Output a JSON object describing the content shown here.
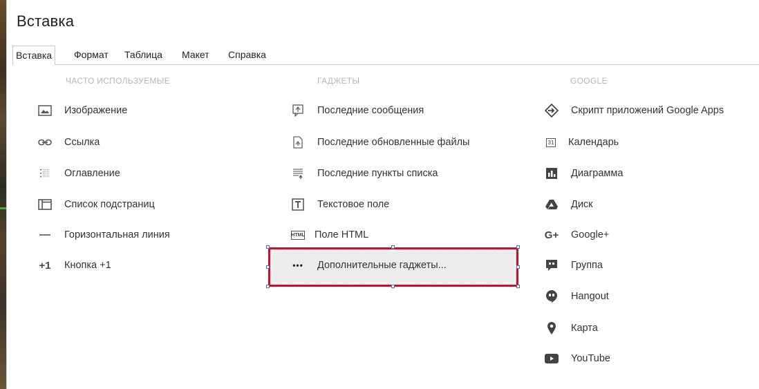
{
  "window": {
    "title": "Вставка"
  },
  "menubar": {
    "tabs": [
      {
        "label": "Вставка",
        "active": true
      },
      {
        "label": "Формат"
      },
      {
        "label": "Таблица"
      },
      {
        "label": "Макет"
      },
      {
        "label": "Справка"
      }
    ]
  },
  "columns": {
    "frequent": {
      "header": "ЧАСТО ИСПОЛЬЗУЕМЫЕ",
      "items": [
        {
          "label": "Изображение",
          "icon": "image-icon"
        },
        {
          "label": "Ссылка",
          "icon": "link-icon"
        },
        {
          "label": "Оглавление",
          "icon": "table-of-contents-icon"
        },
        {
          "label": "Список подстраниц",
          "icon": "subpage-list-icon"
        },
        {
          "label": "Горизонтальная линия",
          "icon": "horizontal-line-icon"
        },
        {
          "label": "Кнопка +1",
          "icon": "plus-one-icon",
          "icon_text": "+1"
        }
      ]
    },
    "gadgets": {
      "header": "ГАДЖЕТЫ",
      "items": [
        {
          "label": "Последние сообщения",
          "icon": "recent-posts-icon"
        },
        {
          "label": "Последние обновленные файлы",
          "icon": "recent-files-icon"
        },
        {
          "label": "Последние пункты списка",
          "icon": "recent-list-items-icon"
        },
        {
          "label": "Текстовое поле",
          "icon": "text-box-icon"
        },
        {
          "label": "Поле HTML",
          "icon": "html-box-icon",
          "icon_text": "HTML"
        },
        {
          "label": "Дополнительные гаджеты...",
          "icon": "more-dots-icon",
          "icon_text": "•••",
          "selected": true
        }
      ]
    },
    "google": {
      "header": "GOOGLE",
      "items": [
        {
          "label": "Скрипт приложений Google Apps",
          "icon": "apps-script-icon"
        },
        {
          "label": "Календарь",
          "icon": "calendar-icon",
          "icon_text": "31"
        },
        {
          "label": "Диаграмма",
          "icon": "chart-icon"
        },
        {
          "label": "Диск",
          "icon": "drive-icon",
          "submenu": true
        },
        {
          "label": "Google+",
          "icon": "google-plus-icon",
          "icon_text": "G+",
          "submenu": true
        },
        {
          "label": "Группа",
          "icon": "groups-icon"
        },
        {
          "label": "Hangout",
          "icon": "hangout-icon",
          "submenu": true
        },
        {
          "label": "Карта",
          "icon": "map-pin-icon"
        },
        {
          "label": "YouTube",
          "icon": "youtube-icon"
        }
      ]
    }
  },
  "colors": {
    "selection_border": "#c8102e",
    "selection_fill": "#ececec",
    "header_text": "#b5b5b5"
  }
}
